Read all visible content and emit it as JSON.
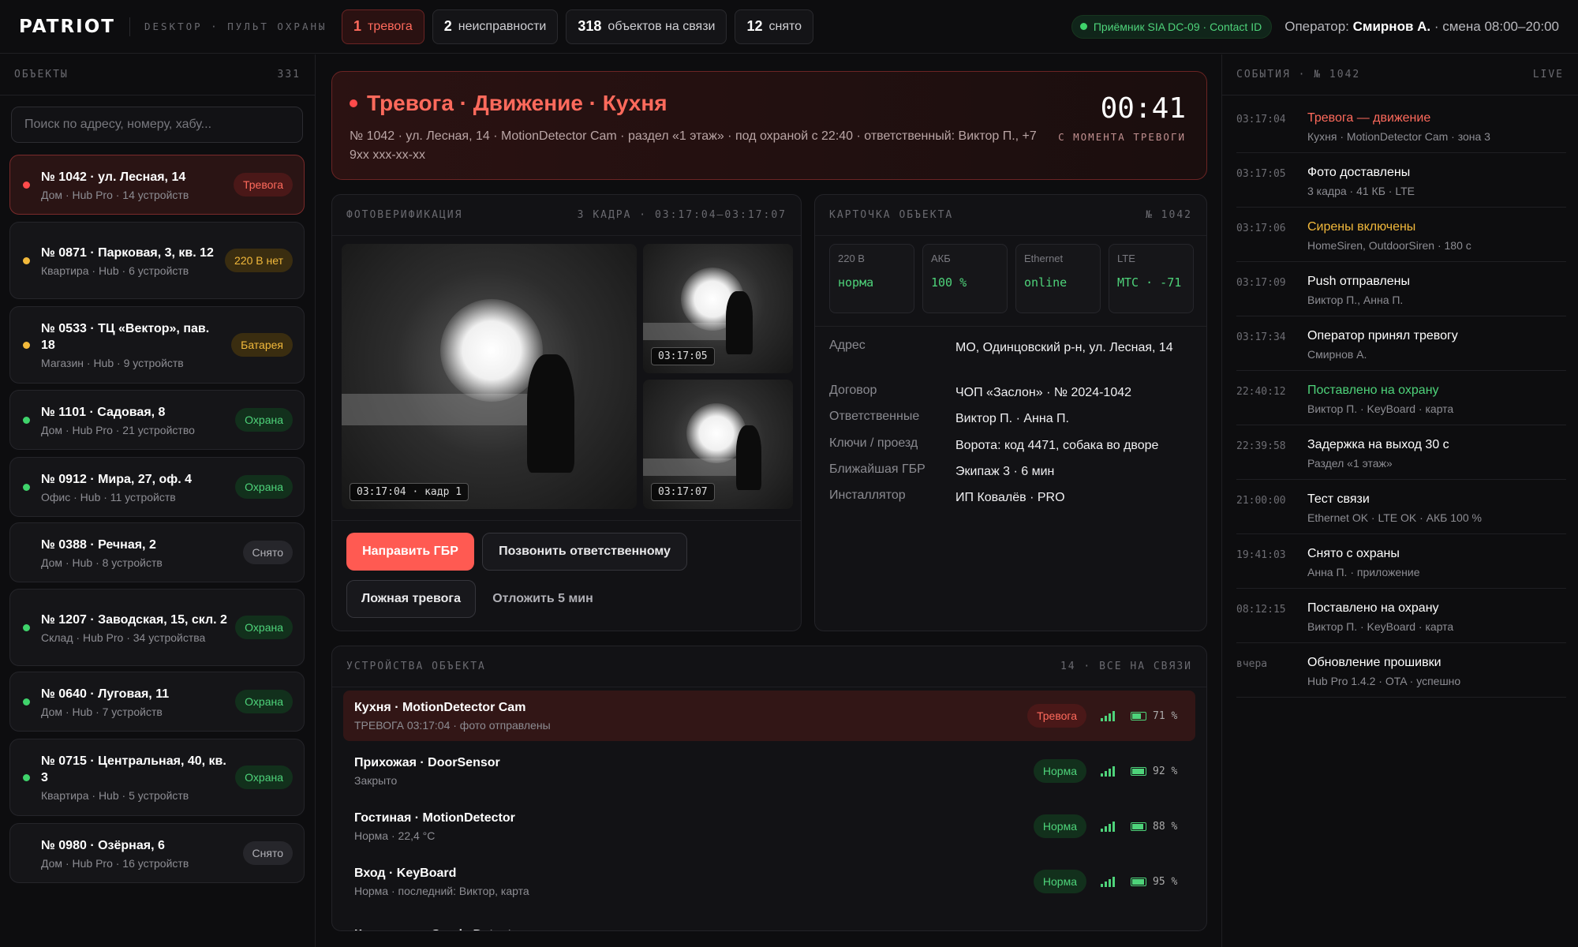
{
  "app": {
    "logo": "PATRIOT",
    "subtitle": "DESKTOP · ПУЛЬТ ОХРАНЫ",
    "stats": [
      {
        "count": "1",
        "label": "тревога"
      },
      {
        "count": "2",
        "label": "неисправности"
      },
      {
        "count": "318",
        "label": "объектов на связи"
      },
      {
        "count": "12",
        "label": "снято"
      }
    ],
    "receiver": "Приёмник SIA DC-09 · Contact ID",
    "operator_label": "Оператор:",
    "operator_name": "Смирнов А.",
    "shift": "· смена 08:00–20:00"
  },
  "objects": {
    "header": "ОБЪЕКТЫ",
    "count": "331",
    "search_placeholder": "Поиск по адресу, номеру, хабу...",
    "items": [
      {
        "title": "№ 1042 · ул. Лесная, 14",
        "sub": "Дом · Hub Pro · 14 устройств",
        "badge": "Тревога",
        "status": "red"
      },
      {
        "title": "№ 0871 · Парковая, 3, кв. 12",
        "sub": "Квартира · Hub · 6 устройств",
        "badge": "220 В нет",
        "status": "yel"
      },
      {
        "title": "№ 0533 · ТЦ «Вектор», пав. 18",
        "sub": "Магазин · Hub · 9 устройств",
        "badge": "Батарея",
        "status": "yel"
      },
      {
        "title": "№ 1101 · Садовая, 8",
        "sub": "Дом · Hub Pro · 21 устройство",
        "badge": "Охрана",
        "status": "grn"
      },
      {
        "title": "№ 0912 · Мира, 27, оф. 4",
        "sub": "Офис · Hub · 11 устройств",
        "badge": "Охрана",
        "status": "grn"
      },
      {
        "title": "№ 0388 · Речная, 2",
        "sub": "Дом · Hub · 8 устройств",
        "badge": "Снято",
        "status": "gry"
      },
      {
        "title": "№ 1207 · Заводская, 15, скл. 2",
        "sub": "Склад · Hub Pro · 34 устройства",
        "badge": "Охрана",
        "status": "grn"
      },
      {
        "title": "№ 0640 · Луговая, 11",
        "sub": "Дом · Hub · 7 устройств",
        "badge": "Охрана",
        "status": "grn"
      },
      {
        "title": "№ 0715 · Центральная, 40, кв. 3",
        "sub": "Квартира · Hub · 5 устройств",
        "badge": "Охрана",
        "status": "grn"
      },
      {
        "title": "№ 0980 · Озёрная, 6",
        "sub": "Дом · Hub Pro · 16 устройств",
        "badge": "Снято",
        "status": "gry"
      }
    ]
  },
  "alarm": {
    "title": "Тревога · Движение · Кухня",
    "details": "№ 1042 · ул. Лесная, 14 · MotionDetector Cam · раздел «1 этаж» · под охраной с 22:40 · ответственный: Виктор П., +7 9xx xxx-xx-xx",
    "timer": "00:41",
    "timer_label": "С МОМЕНТА ТРЕВОГИ"
  },
  "photo": {
    "header": "ФОТОВЕРИФИКАЦИЯ",
    "meta": "3 КАДРА · 03:17:04–03:17:07",
    "frames": [
      "03:17:04 · кадр 1",
      "03:17:05",
      "03:17:07"
    ],
    "actions": {
      "dispatch": "Направить ГБР",
      "call": "Позвонить ответственному",
      "false_alarm": "Ложная тревога",
      "snooze": "Отложить 5 мин"
    }
  },
  "card": {
    "header": "КАРТОЧКА ОБЪЕКТА",
    "number": "№ 1042",
    "tiles": [
      {
        "k": "220 В",
        "v": "норма"
      },
      {
        "k": "АКБ",
        "v": "100 %"
      },
      {
        "k": "Ethernet",
        "v": "online"
      },
      {
        "k": "LTE",
        "v": "МТС · -71"
      }
    ],
    "fields": [
      {
        "k": "Адрес",
        "v": "МО, Одинцовский р-н, ул. Лесная, 14"
      },
      {
        "k": "Договор",
        "v": "ЧОП «Заслон» · № 2024-1042"
      },
      {
        "k": "Ответственные",
        "v": "Виктор П. · Анна П."
      },
      {
        "k": "Ключи / проезд",
        "v": "Ворота: код 4471, собака во дворе"
      },
      {
        "k": "Ближайшая ГБР",
        "v": "Экипаж 3 · 6 мин"
      },
      {
        "k": "Инсталлятор",
        "v": "ИП Ковалёв · PRO"
      }
    ]
  },
  "devices": {
    "header": "УСТРОЙСТВА ОБЪЕКТА",
    "meta": "14 · ВСЕ НА СВЯЗИ",
    "items": [
      {
        "name": "Кухня · MotionDetector Cam",
        "state": "ТРЕВОГА 03:17:04 · фото отправлены",
        "badge": "Тревога",
        "status": "red",
        "battery": "71 %",
        "battery_level": 0.71,
        "signal": 4
      },
      {
        "name": "Прихожая · DoorSensor",
        "state": "Закрыто",
        "badge": "Норма",
        "status": "grn",
        "battery": "92 %",
        "battery_level": 0.92,
        "signal": 4
      },
      {
        "name": "Гостиная · MotionDetector",
        "state": "Норма · 22,4 °C",
        "badge": "Норма",
        "status": "grn",
        "battery": "88 %",
        "battery_level": 0.88,
        "signal": 4
      },
      {
        "name": "Вход · KeyBoard",
        "state": "Норма · последний: Виктор, карта",
        "badge": "Норма",
        "status": "grn",
        "battery": "95 %",
        "battery_level": 0.95,
        "signal": 4
      },
      {
        "name": "Котельная · SmokeDetector",
        "state": "",
        "badge": "",
        "status": "grn",
        "battery": "",
        "battery_level": 0,
        "signal": 0
      }
    ]
  },
  "events": {
    "header": "СОБЫТИЯ · № 1042",
    "live": "LIVE",
    "items": [
      {
        "time": "03:17:04",
        "title": "Тревога — движение",
        "sub": "Кухня · MotionDetector Cam · зона 3",
        "tone": "red"
      },
      {
        "time": "03:17:05",
        "title": "Фото доставлены",
        "sub": "3 кадра · 41 КБ · LTE",
        "tone": ""
      },
      {
        "time": "03:17:06",
        "title": "Сирены включены",
        "sub": "HomeSiren, OutdoorSiren · 180 с",
        "tone": "yel"
      },
      {
        "time": "03:17:09",
        "title": "Push отправлены",
        "sub": "Виктор П., Анна П.",
        "tone": ""
      },
      {
        "time": "03:17:34",
        "title": "Оператор принял тревогу",
        "sub": "Смирнов А.",
        "tone": ""
      },
      {
        "time": "22:40:12",
        "title": "Поставлено на охрану",
        "sub": "Виктор П. · KeyBoard · карта",
        "tone": "grn"
      },
      {
        "time": "22:39:58",
        "title": "Задержка на выход 30 с",
        "sub": "Раздел «1 этаж»",
        "tone": ""
      },
      {
        "time": "21:00:00",
        "title": "Тест связи",
        "sub": "Ethernet OK · LTE OK · АКБ 100 %",
        "tone": ""
      },
      {
        "time": "19:41:03",
        "title": "Снято с охраны",
        "sub": "Анна П. · приложение",
        "tone": ""
      },
      {
        "time": "08:12:15",
        "title": "Поставлено на охрану",
        "sub": "Виктор П. · KeyBoard · карта",
        "tone": ""
      },
      {
        "time": "вчера",
        "title": "Обновление прошивки",
        "sub": "Hub Pro 1.4.2 · OTA · успешно",
        "tone": ""
      }
    ]
  }
}
